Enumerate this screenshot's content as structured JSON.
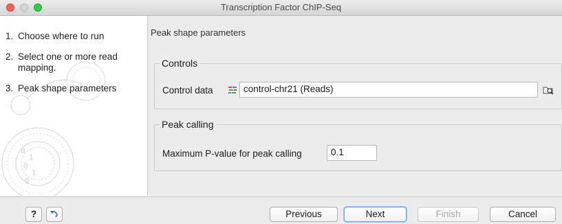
{
  "window": {
    "title": "Transcription Factor ChIP-Seq"
  },
  "sidebar": {
    "steps": [
      {
        "num": "1.",
        "label": "Choose where to run"
      },
      {
        "num": "2.",
        "label": "Select one or more read mapping."
      },
      {
        "num": "3.",
        "label": "Peak shape parameters"
      }
    ]
  },
  "main": {
    "heading": "Peak shape parameters",
    "controls": {
      "legend": "Controls",
      "control_label": "Control data",
      "control_value": "control-chr21 (Reads)",
      "reads_icon": "reads-icon",
      "browse_icon": "folder-browse-icon"
    },
    "peak_calling": {
      "legend": "Peak calling",
      "pvalue_label": "Maximum P-value for peak calling",
      "pvalue_value": "0.1"
    }
  },
  "footer": {
    "help_label": "?",
    "help_icon": "question-icon",
    "reset_icon": "undo-arrow-icon",
    "previous_label": "Previous",
    "next_label": "Next",
    "finish_label": "Finish",
    "cancel_label": "Cancel"
  },
  "colors": {
    "primary_border": "#6fa4e8",
    "close": "#fc5b57",
    "maximize": "#35c94a"
  }
}
